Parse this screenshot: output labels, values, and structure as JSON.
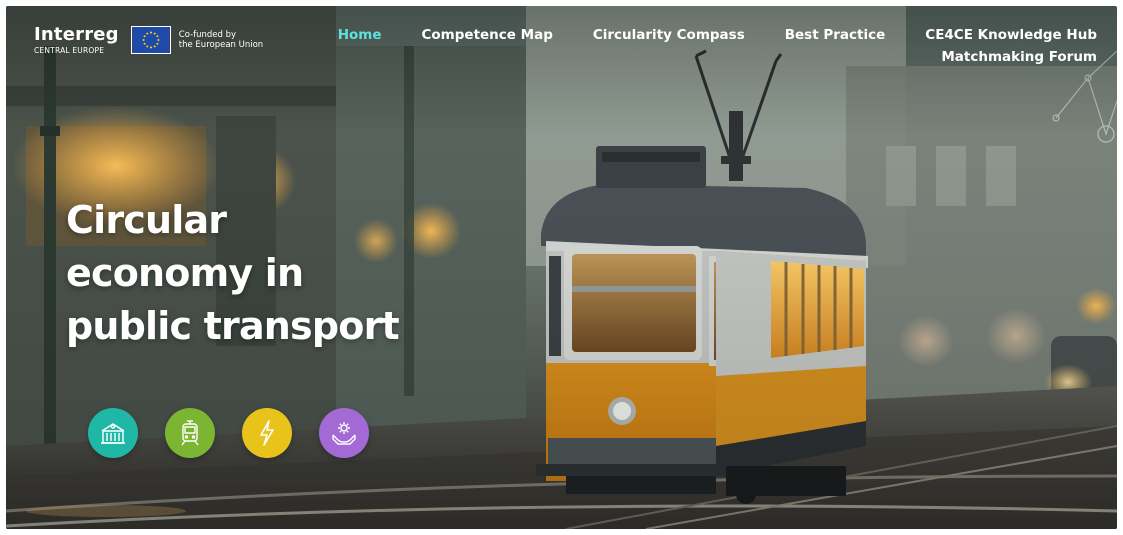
{
  "header": {
    "logo": {
      "brand": "Interreg",
      "region": "CENTRAL EUROPE",
      "cofunded_line1": "Co-funded by",
      "cofunded_line2": "the European Union"
    },
    "nav": {
      "home": "Home",
      "competence_map": "Competence Map",
      "circularity_compass": "Circularity Compass",
      "best_practice": "Best Practice",
      "knowledge_hub": "CE4CE Knowledge Hub",
      "matchmaking_forum": "Matchmaking Forum"
    },
    "active_nav": "home"
  },
  "hero": {
    "title_line1": "Circular",
    "title_line2": "economy in",
    "title_line3": "public transport"
  },
  "categories": [
    {
      "icon": "building-icon",
      "color": "#1fb8a6"
    },
    {
      "icon": "tram-icon",
      "color": "#7cb532"
    },
    {
      "icon": "lightning-icon",
      "color": "#e8c31a"
    },
    {
      "icon": "hands-gear-icon",
      "color": "#a36ad6"
    }
  ],
  "colors": {
    "nav_active": "#5fe0dc",
    "nav_text": "#ffffff",
    "tram_body": "#e89a1c",
    "tram_roof": "#4a5257"
  }
}
